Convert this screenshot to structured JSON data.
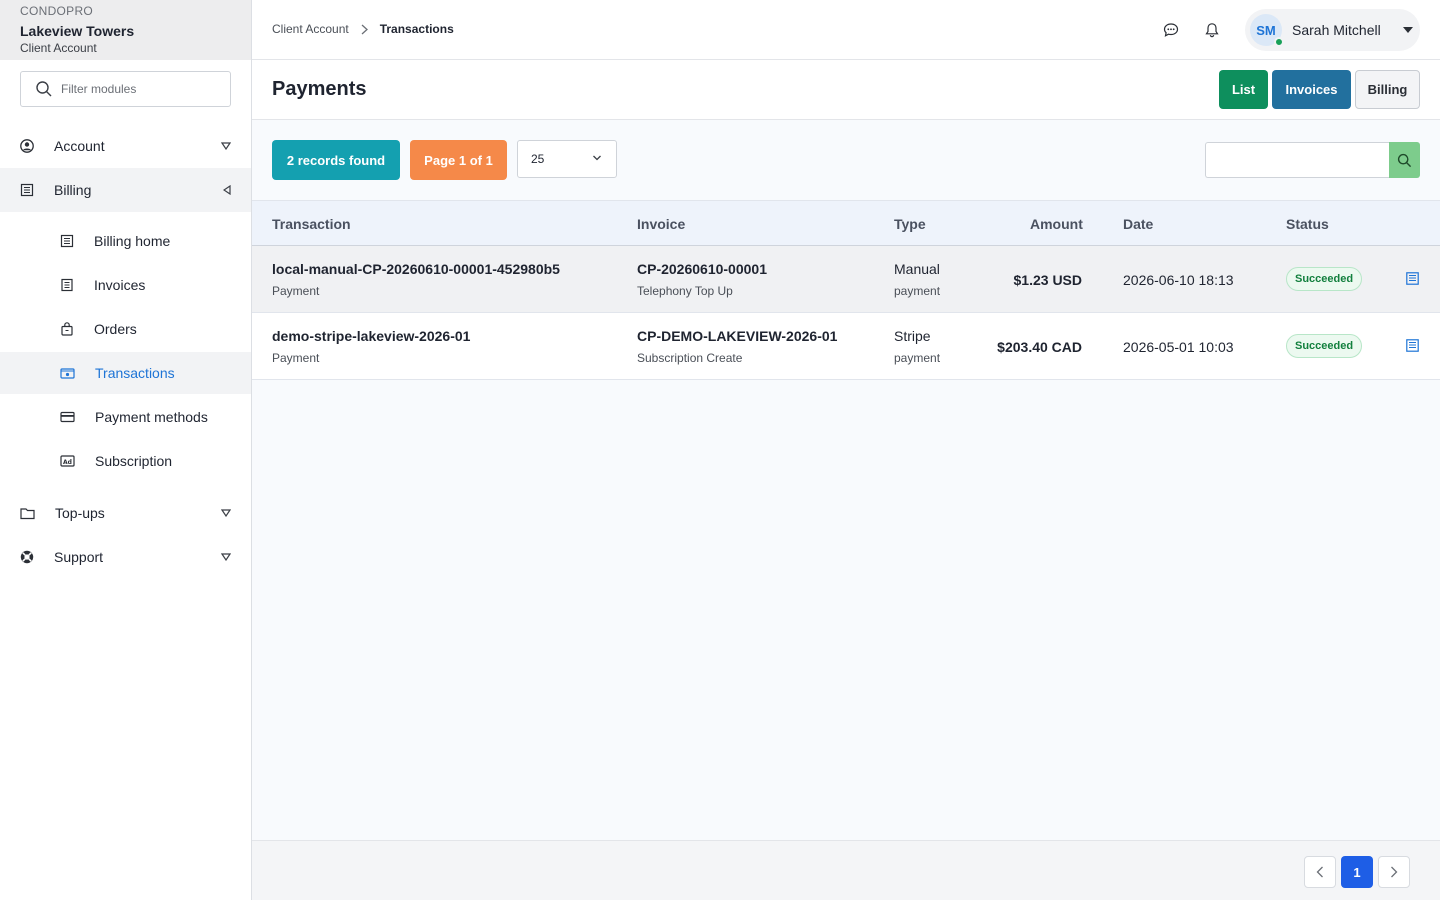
{
  "brand": {
    "app": "CONDOPRO",
    "org": "Lakeview Towers",
    "context": "Client Account"
  },
  "sidebar": {
    "filter_placeholder": "Filter modules",
    "sections": [
      {
        "label": "Account",
        "icon": "user-circle-icon",
        "state": "collapsed"
      },
      {
        "label": "Billing",
        "icon": "ledger-icon",
        "state": "expanded"
      },
      {
        "label": "Top-ups",
        "icon": "folder-icon",
        "state": "collapsed"
      },
      {
        "label": "Support",
        "icon": "lifebuoy-icon",
        "state": "collapsed"
      }
    ],
    "billing_items": [
      {
        "label": "Billing home",
        "icon": "ledger-icon"
      },
      {
        "label": "Invoices",
        "icon": "invoice-icon"
      },
      {
        "label": "Orders",
        "icon": "shopping-bag-icon"
      },
      {
        "label": "Transactions",
        "icon": "cash-icon",
        "active": true
      },
      {
        "label": "Payment methods",
        "icon": "credit-card-icon"
      },
      {
        "label": "Subscription",
        "icon": "ad-card-icon"
      }
    ]
  },
  "header": {
    "breadcrumb": [
      "Client Account",
      "Transactions"
    ],
    "user": {
      "initials": "SM",
      "name": "Sarah Mitchell",
      "online": true
    }
  },
  "page": {
    "title": "Payments",
    "view_buttons": [
      "List",
      "Invoices",
      "Billing"
    ]
  },
  "toolbar": {
    "records": "2 records found",
    "page_info": "Page 1 of 1",
    "per_page": "25",
    "search_value": ""
  },
  "table": {
    "headers": [
      "Transaction",
      "Invoice",
      "Type",
      "Amount",
      "Date",
      "Status"
    ],
    "rows": [
      {
        "transaction": "local-manual-CP-20260610-00001-452980b5",
        "transaction_kind": "Payment",
        "invoice": "CP-20260610-00001",
        "invoice_desc": "Telephony Top Up",
        "type": "Manual",
        "type_sub": "payment",
        "amount": "$1.23 USD",
        "date": "2026-06-10 18:13",
        "status": "Succeeded"
      },
      {
        "transaction": "demo-stripe-lakeview-2026-01",
        "transaction_kind": "Payment",
        "invoice": "CP-DEMO-LAKEVIEW-2026-01",
        "invoice_desc": "Subscription Create",
        "type": "Stripe",
        "type_sub": "payment",
        "amount": "$203.40 CAD",
        "date": "2026-05-01 10:03",
        "status": "Succeeded"
      }
    ]
  },
  "pagination": {
    "current": "1"
  },
  "colors": {
    "list_button": "#0e8f5d",
    "invoices_button": "#22709e",
    "records_badge": "#14a0b0",
    "page_badge": "#f58949",
    "active_nav_text": "#1e74d6",
    "success": "#13803e",
    "current_page": "#1e5ee6"
  }
}
